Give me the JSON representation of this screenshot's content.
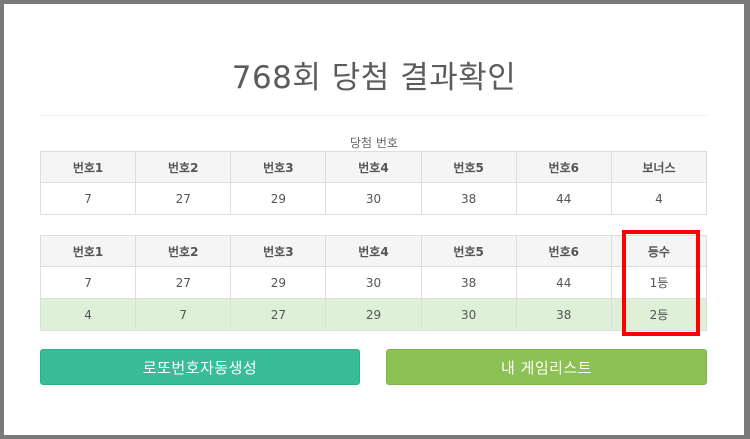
{
  "title": "768회 당첨 결과확인",
  "winning": {
    "caption": "당첨 번호",
    "headers": [
      "번호1",
      "번호2",
      "번호3",
      "번호4",
      "번호5",
      "번호6",
      "보너스"
    ],
    "values": [
      "7",
      "27",
      "29",
      "30",
      "38",
      "44",
      "4"
    ]
  },
  "results": {
    "headers": [
      "번호1",
      "번호2",
      "번호3",
      "번호4",
      "번호5",
      "번호6",
      "등수"
    ],
    "rows": [
      [
        "7",
        "27",
        "29",
        "30",
        "38",
        "44",
        "1등"
      ],
      [
        "4",
        "7",
        "27",
        "29",
        "30",
        "38",
        "2등"
      ]
    ]
  },
  "buttons": {
    "auto": "로또번호자동생성",
    "list": "내 게임리스트"
  },
  "colors": {
    "auto_button": "#39bd98",
    "list_button": "#8cc153",
    "highlight_row": "#dff0d8",
    "annotation_box": "#ff0000"
  }
}
